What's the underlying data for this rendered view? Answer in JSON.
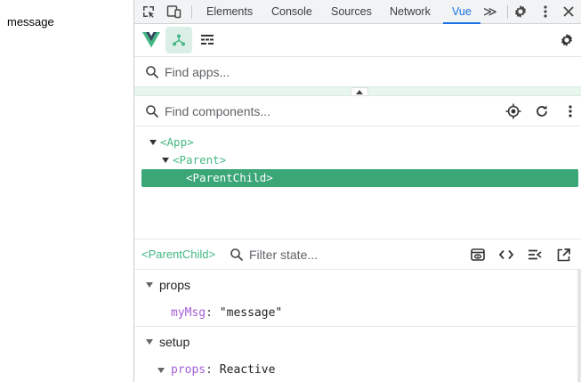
{
  "page": {
    "text": "message"
  },
  "devtools": {
    "tabs": [
      {
        "label": "Elements"
      },
      {
        "label": "Console"
      },
      {
        "label": "Sources"
      },
      {
        "label": "Network"
      },
      {
        "label": "Vue"
      }
    ],
    "active_tab": "Vue",
    "more_tabs_glyph": "≫",
    "accent": "#1a73e8"
  },
  "vue": {
    "accent": "#42b883",
    "app_search": {
      "placeholder": "Find apps..."
    },
    "component_search": {
      "placeholder": "Find components..."
    },
    "tree": [
      {
        "label": "<App>",
        "expanded": true
      },
      {
        "label": "<Parent>",
        "expanded": true
      },
      {
        "label": "<ParentChild>",
        "selected": true
      }
    ],
    "inspector": {
      "title": "<ParentChild>",
      "filter": {
        "placeholder": "Filter state..."
      }
    },
    "state": {
      "props_section": "props",
      "props": [
        {
          "key": "myMsg",
          "sep": ":",
          "value": "\"message\""
        }
      ],
      "setup_section": "setup",
      "setup": [
        {
          "key": "props",
          "sep": ":",
          "value": "Reactive"
        }
      ]
    }
  }
}
